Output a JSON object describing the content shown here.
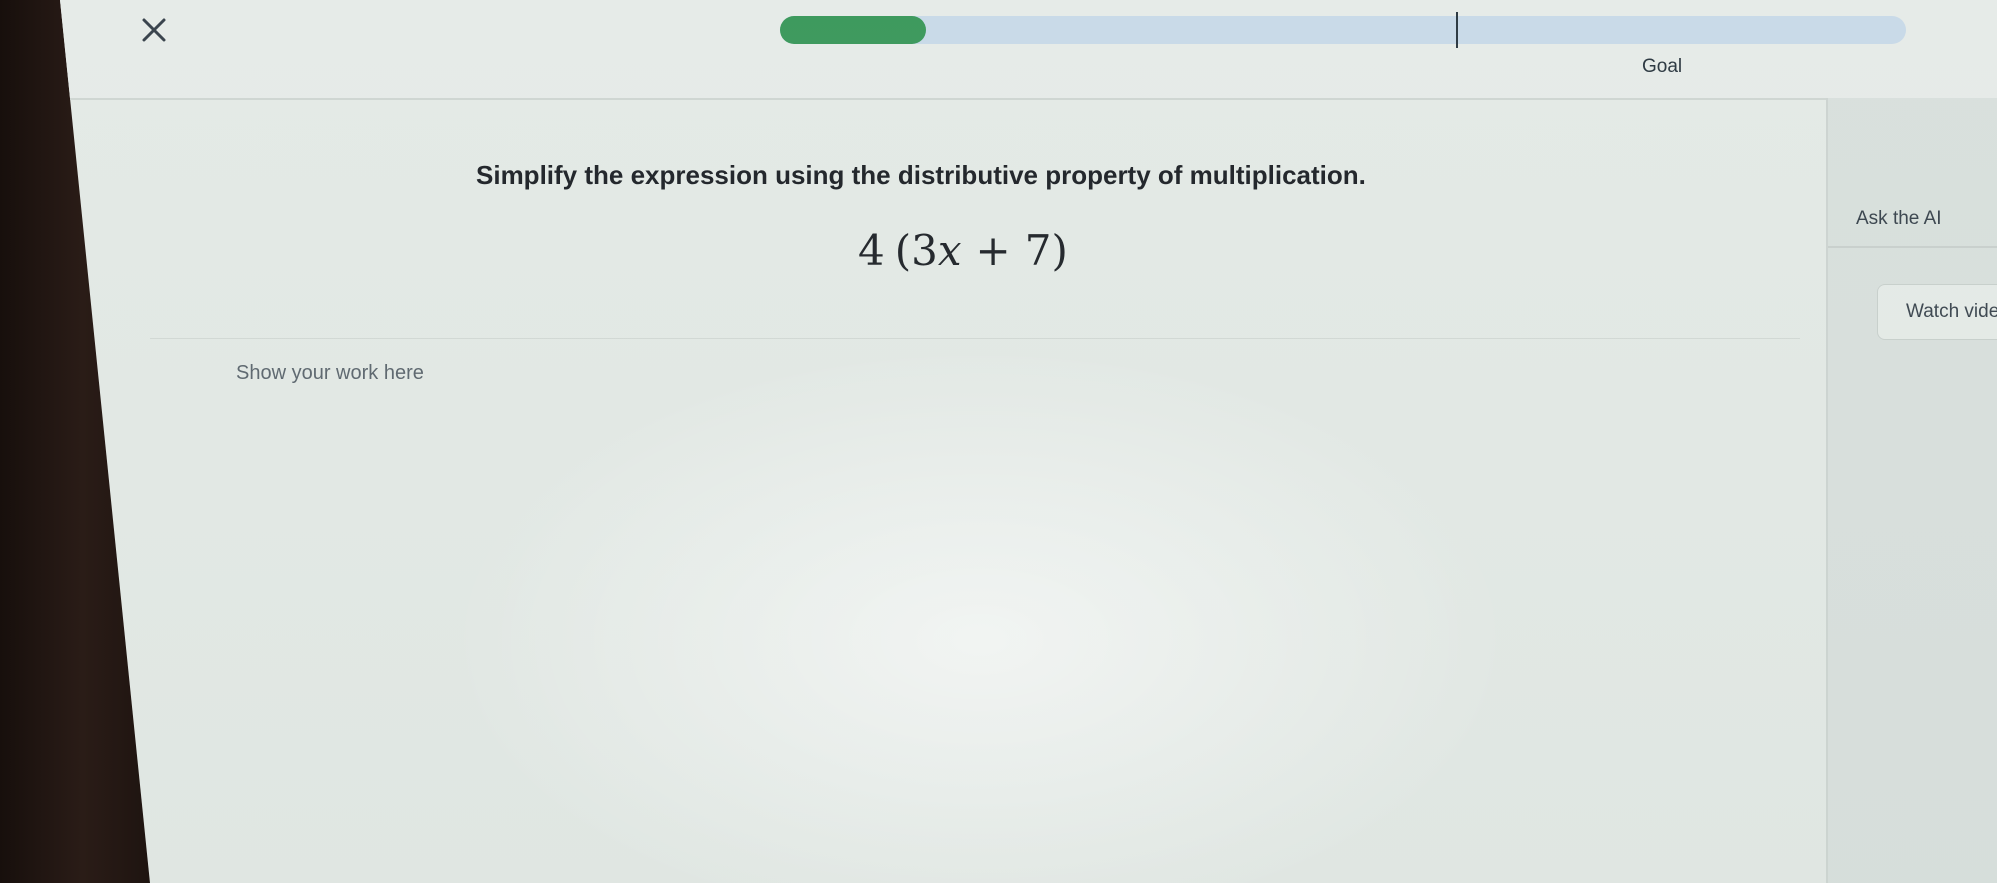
{
  "header": {
    "close_label": "close",
    "progress": 0.13,
    "goal_position": 0.6,
    "goal_label": "Goal",
    "colors": {
      "progress_fill": "#3e9a5e",
      "progress_track": "#c9dae8"
    }
  },
  "main": {
    "question": "Simplify the expression using the distributive property of multiplication.",
    "expression": {
      "coefficient": "4",
      "open": "(",
      "term_coef": "3",
      "variable": "x",
      "operator": "+",
      "constant": "7",
      "close": ")"
    },
    "work_placeholder": "Show your work here"
  },
  "side_panel": {
    "ask_ai_label": "Ask the AI",
    "watch_video_label": "Watch video"
  }
}
